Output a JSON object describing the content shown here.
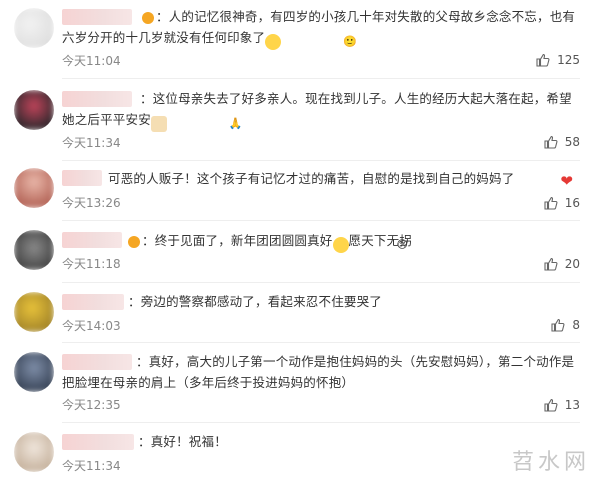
{
  "comments": [
    {
      "prefix": "：",
      "text": "人的记忆很神奇，有四岁的小孩几十年对失散的父母故乡念念不忘，也有六岁分开的十几岁就没有任何印象了",
      "emoji": "🙂",
      "time": "今天11:04",
      "likes": "125"
    },
    {
      "prefix": "：",
      "text": "这位母亲失去了好多亲人。现在找到儿子。人生的经历大起大落在起，希望她之后平平安安",
      "emoji": "🙏",
      "time": "今天11:34",
      "likes": "58"
    },
    {
      "prefix": "",
      "text": "可恶的人贩子！这个孩子有记忆才过的痛苦，自慰的是找到自己的妈妈了",
      "emoji": "❤",
      "time": "今天13:26",
      "likes": "16"
    },
    {
      "prefix": "：",
      "text": "终于见面了，新年团团圆圆真好",
      "emoji": "😢",
      "text2": "愿天下无拐",
      "time": "今天11:18",
      "likes": "20"
    },
    {
      "prefix": "：",
      "text": "旁边的警察都感动了，看起来忍不住要哭了",
      "time": "今天14:03",
      "likes": "8"
    },
    {
      "prefix": "：",
      "text": "真好，高大的儿子第一个动作是抱住妈妈的头（先安慰妈妈），第二个动作是把脸埋在母亲的肩上（多年后终于投进妈妈的怀抱）",
      "time": "今天12:35",
      "likes": "13"
    },
    {
      "prefix": "：",
      "text": "真好！祝福！",
      "time": "今天11:34",
      "likes": ""
    }
  ],
  "watermark": "苕水网",
  "icons": {
    "like": "thumbs-up-icon"
  }
}
